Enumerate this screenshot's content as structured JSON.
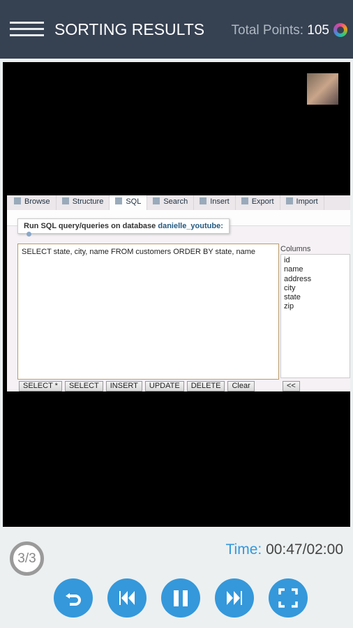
{
  "header": {
    "title": "SORTING RESULTS",
    "points_label": "Total Points:",
    "points_value": "105"
  },
  "pma": {
    "tabs": [
      "Browse",
      "Structure",
      "SQL",
      "Search",
      "Insert",
      "Export",
      "Import"
    ],
    "legend_prefix": "Run SQL query/queries on database",
    "database": "danielle_youtube:",
    "query": "SELECT state, city, name FROM customers ORDER BY state, name",
    "columns_label": "Columns",
    "columns": [
      "id",
      "name",
      "address",
      "city",
      "state",
      "zip"
    ],
    "buttons": [
      "SELECT *",
      "SELECT",
      "INSERT",
      "UPDATE",
      "DELETE",
      "Clear"
    ],
    "insert_column_button": "<<"
  },
  "player": {
    "counter": "3/3",
    "time_label": "Time:",
    "time_value": "00:47/02:00"
  },
  "colors": {
    "header": "#364152",
    "accent": "#3498db"
  }
}
